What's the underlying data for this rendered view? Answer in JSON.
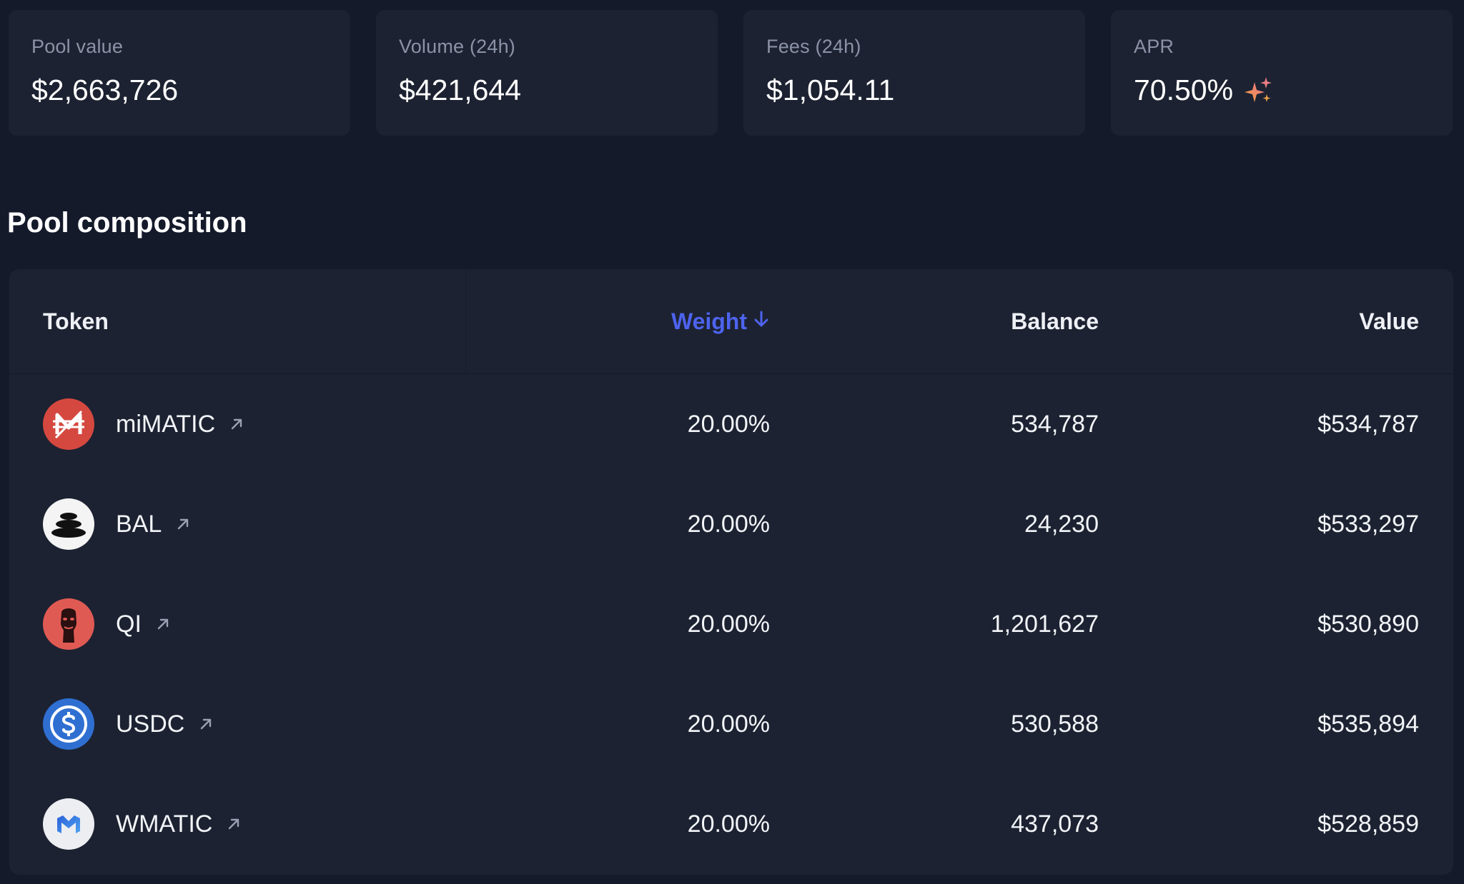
{
  "stats": [
    {
      "label": "Pool value",
      "value": "$2,663,726"
    },
    {
      "label": "Volume (24h)",
      "value": "$421,644"
    },
    {
      "label": "Fees (24h)",
      "value": "$1,054.11"
    },
    {
      "label": "APR",
      "value": "70.50%"
    }
  ],
  "composition": {
    "title": "Pool composition",
    "headers": {
      "token": "Token",
      "weight": "Weight",
      "balance": "Balance",
      "value": "Value"
    },
    "rows": [
      {
        "token": "miMATIC",
        "weight": "20.00%",
        "balance": "534,787",
        "value": "$534,787"
      },
      {
        "token": "BAL",
        "weight": "20.00%",
        "balance": "24,230",
        "value": "$533,297"
      },
      {
        "token": "QI",
        "weight": "20.00%",
        "balance": "1,201,627",
        "value": "$530,890"
      },
      {
        "token": "USDC",
        "weight": "20.00%",
        "balance": "530,588",
        "value": "$535,894"
      },
      {
        "token": "WMATIC",
        "weight": "20.00%",
        "balance": "437,073",
        "value": "$528,859"
      }
    ]
  },
  "colors": {
    "background": "#141a2a",
    "card": "#1c2231",
    "accent": "#4d63ee",
    "muted": "#8b93a7"
  },
  "icons": {
    "apr_boost": "sparkle-icon",
    "sort": "arrow-down-icon",
    "external": "arrow-up-right-icon"
  }
}
